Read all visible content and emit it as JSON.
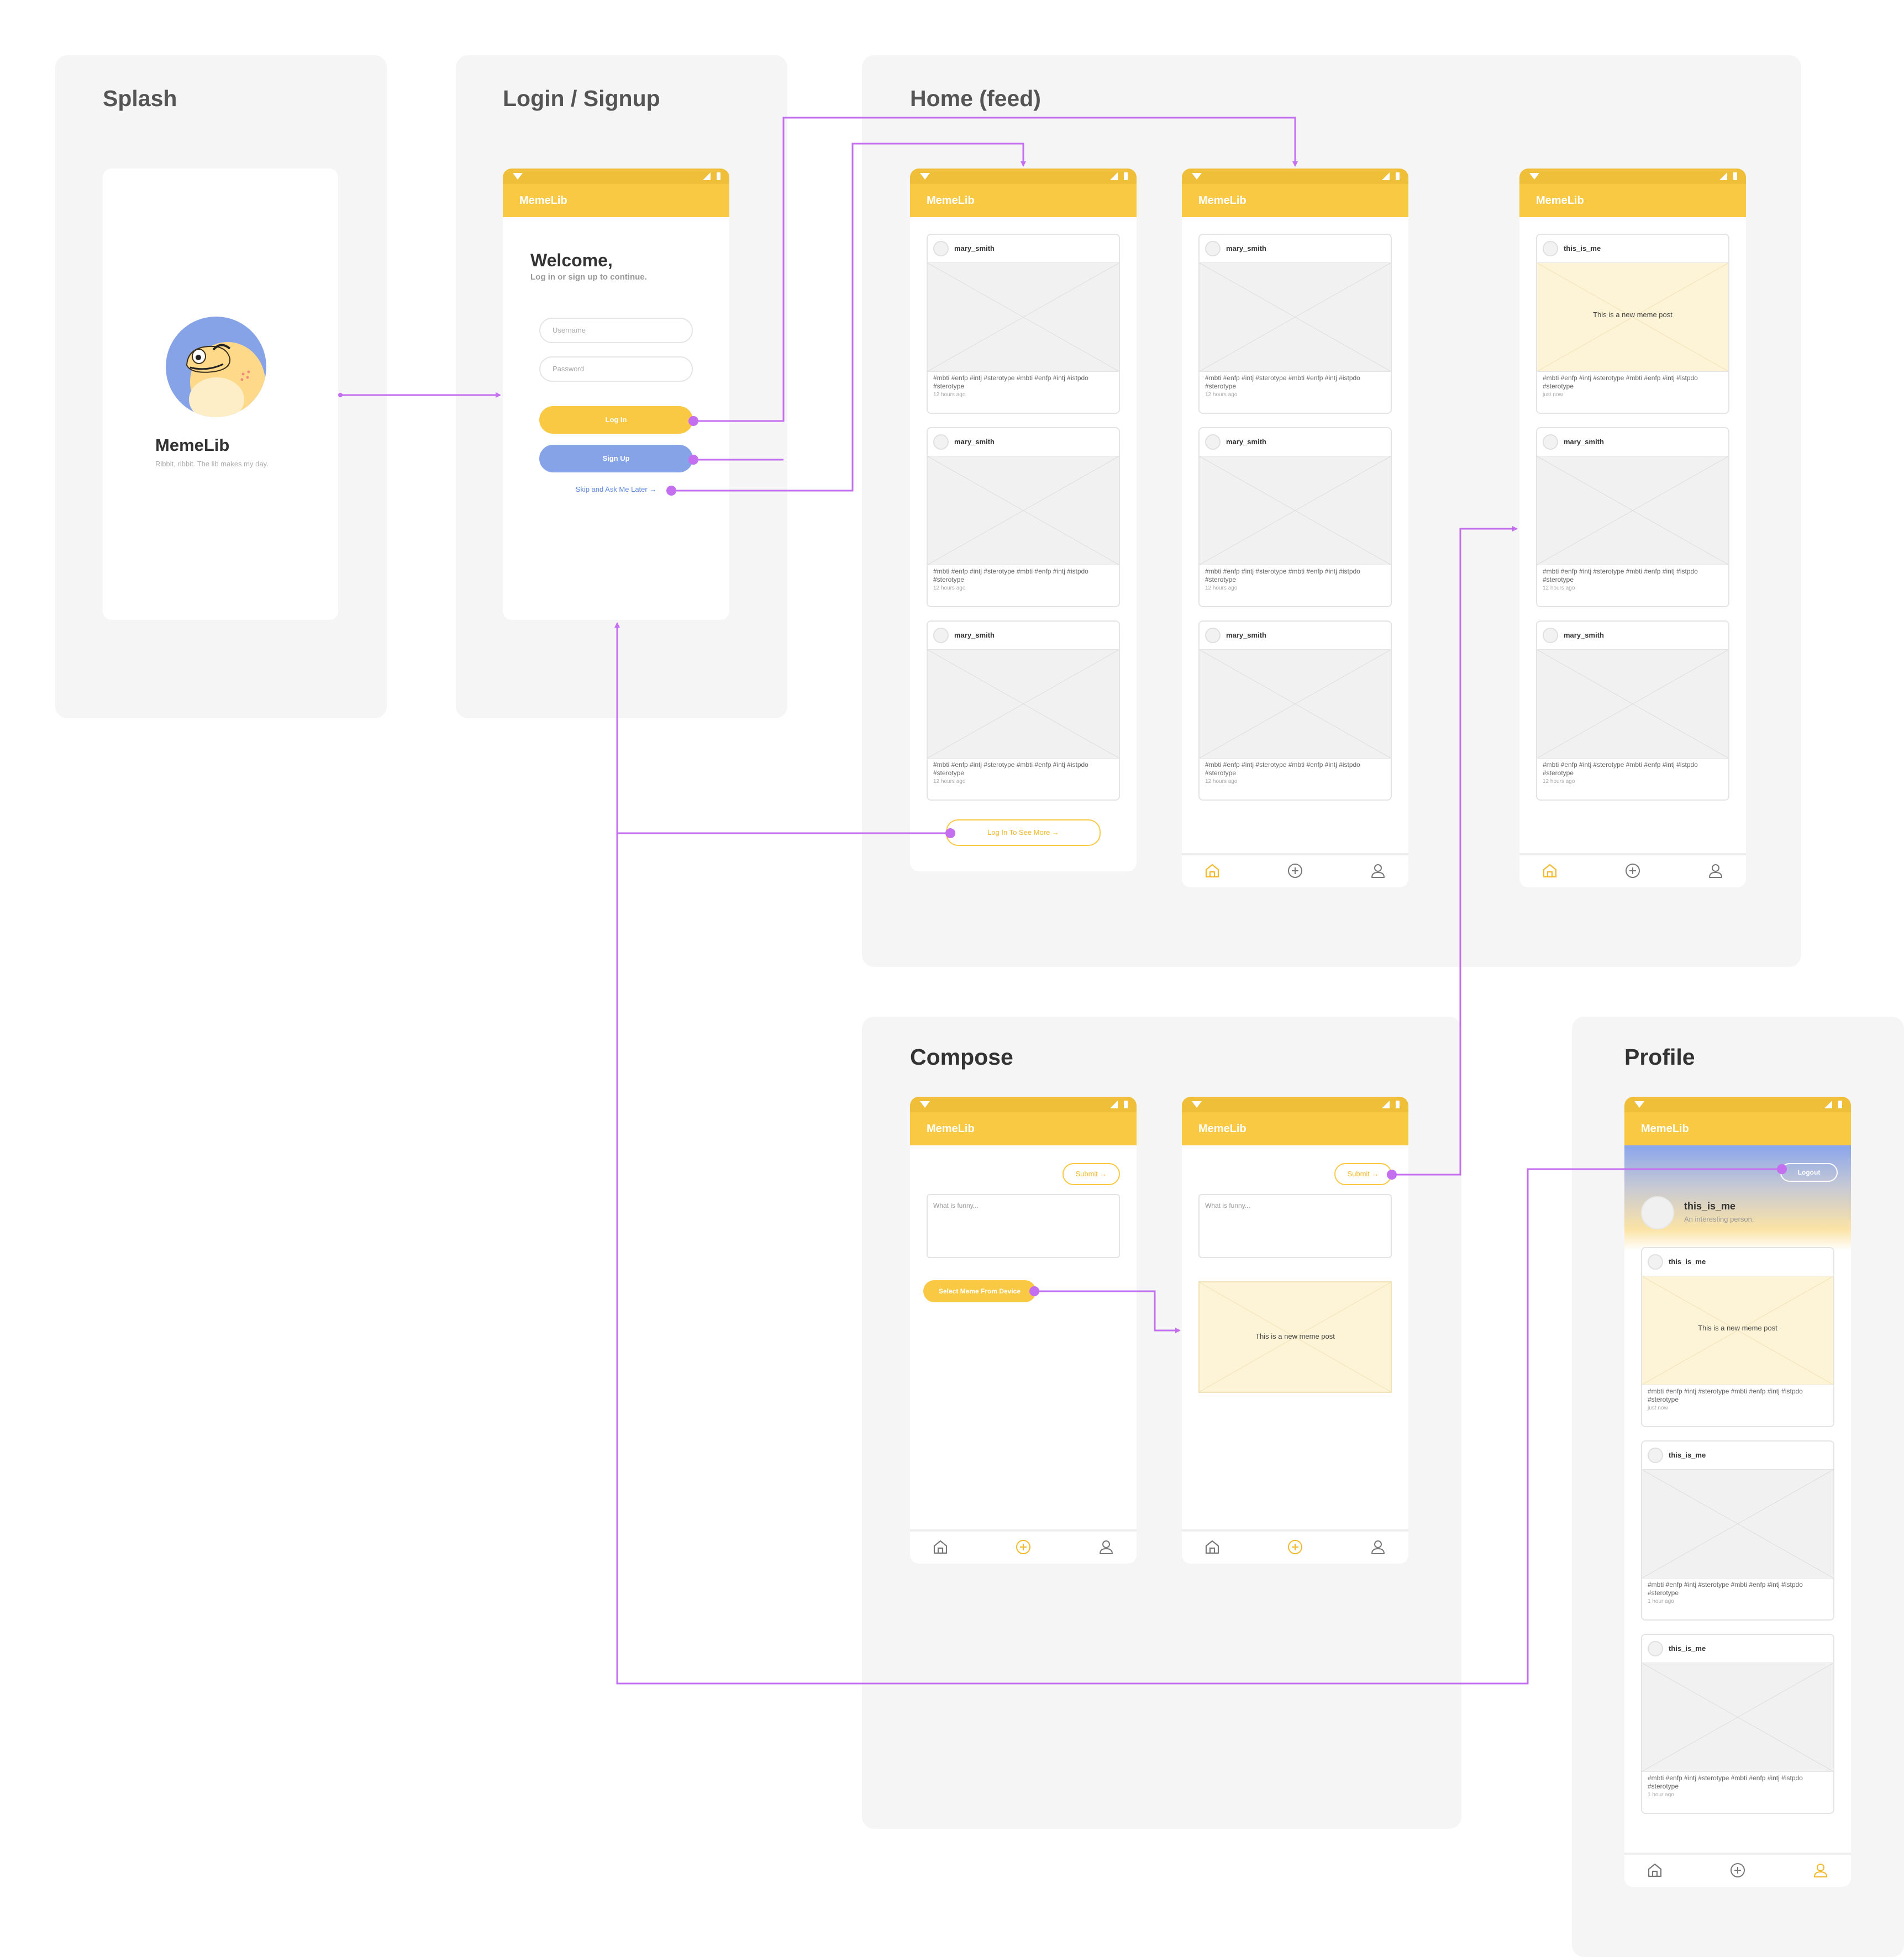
{
  "sections": {
    "splash": "Splash",
    "login": "Login / Signup",
    "home": "Home (feed)",
    "compose": "Compose",
    "profile": "Profile"
  },
  "app_name": "MemeLib",
  "splash": {
    "title": "MemeLib",
    "tagline": "Ribbit, ribbit. The lib makes my day."
  },
  "login": {
    "welcome": "Welcome,",
    "subtitle": "Log in or sign up to continue.",
    "username_placeholder": "Username",
    "password_placeholder": "Password",
    "login_button": "Log In",
    "signup_button": "Sign Up",
    "skip_link": "Skip and Ask Me Later →"
  },
  "post": {
    "user": "mary_smith",
    "me": "this_is_me",
    "tags": "#mbti #enfp #intj #sterotype #mbti #enfp #intj #istpdo #sterotype",
    "time_12h": "12 hours ago",
    "time_now": "just now",
    "time_1h": "1 hour ago",
    "new_meme_text": "This is a new meme post"
  },
  "feed": {
    "see_more_button": "Log In To See More →"
  },
  "compose": {
    "submit_button": "Submit →",
    "text_placeholder": "What is funny...",
    "select_button": "Select Meme From Device"
  },
  "profile": {
    "logout_button": "Logout",
    "username": "this_is_me",
    "bio": "An interesting person."
  },
  "colors": {
    "brand_yellow": "#f9c944",
    "status_yellow": "#efbf3a",
    "accent_blue": "#86a3e8",
    "link_blue": "#5b87e0",
    "connector_purple": "#c46ef0",
    "section_bg": "#f5f5f5"
  }
}
